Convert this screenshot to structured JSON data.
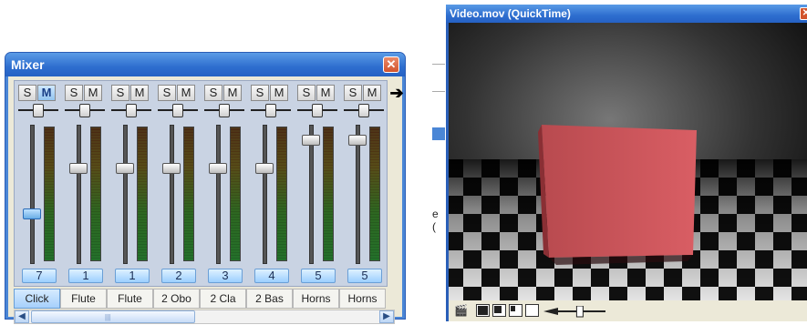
{
  "mixer": {
    "title": "Mixer",
    "close_glyph": "✕",
    "more_glyph": "➔",
    "channels": [
      {
        "tab": "Click",
        "number": "7",
        "solo": "S",
        "mute": "M",
        "mute_on": true,
        "fader_level": 0.35,
        "pan": 0.5,
        "tab_active": true,
        "fader_active": true
      },
      {
        "tab": "Flute",
        "number": "1",
        "solo": "S",
        "mute": "M",
        "mute_on": false,
        "fader_level": 0.7,
        "pan": 0.5
      },
      {
        "tab": "Flute",
        "number": "1",
        "solo": "S",
        "mute": "M",
        "mute_on": false,
        "fader_level": 0.7,
        "pan": 0.5
      },
      {
        "tab": "2 Obo",
        "number": "2",
        "solo": "S",
        "mute": "M",
        "mute_on": false,
        "fader_level": 0.7,
        "pan": 0.5
      },
      {
        "tab": "2 Cla",
        "number": "3",
        "solo": "S",
        "mute": "M",
        "mute_on": false,
        "fader_level": 0.7,
        "pan": 0.5
      },
      {
        "tab": "2 Bas",
        "number": "4",
        "solo": "S",
        "mute": "M",
        "mute_on": false,
        "fader_level": 0.7,
        "pan": 0.5
      },
      {
        "tab": "Horns",
        "number": "5",
        "solo": "S",
        "mute": "M",
        "mute_on": false,
        "fader_level": 0.92,
        "pan": 0.5
      },
      {
        "tab": "Horns",
        "number": "5",
        "solo": "S",
        "mute": "M",
        "mute_on": false,
        "fader_level": 0.92,
        "pan": 0.5
      }
    ],
    "scrollbar": {
      "left_glyph": "◀",
      "right_glyph": "▶",
      "grip": "|||"
    }
  },
  "background_peek": {
    "chars": [
      "e",
      "("
    ]
  },
  "video": {
    "title": "Video.mov (QuickTime)",
    "close_glyph": "✕",
    "controls": {
      "clapper_icon": "clapperboard-icon",
      "volume_level": 0.45
    }
  }
}
